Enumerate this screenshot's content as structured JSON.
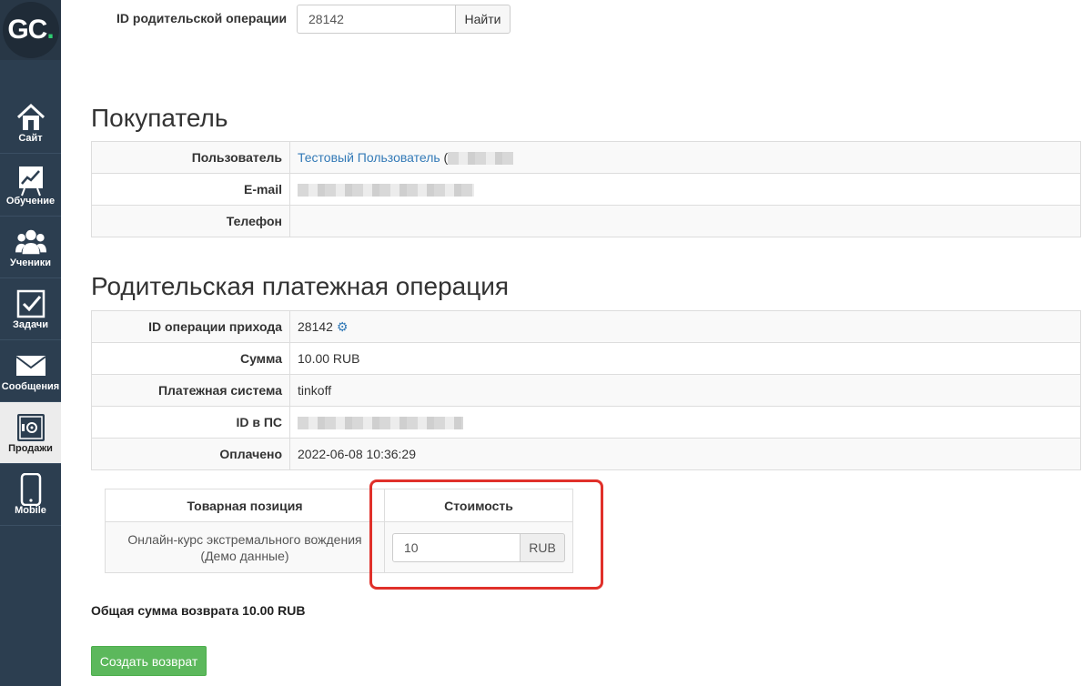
{
  "sidebar": {
    "logo_text": "GC",
    "logo_dot": ".",
    "items": [
      {
        "label": "Сайт",
        "icon": "home-icon"
      },
      {
        "label": "Обучение",
        "icon": "chart-board-icon"
      },
      {
        "label": "Ученики",
        "icon": "users-icon"
      },
      {
        "label": "Задачи",
        "icon": "checkbox-icon"
      },
      {
        "label": "Сообщения",
        "icon": "envelope-icon"
      },
      {
        "label": "Продажи",
        "icon": "safe-icon"
      },
      {
        "label": "Mobile",
        "icon": "phone-icon"
      }
    ],
    "active_index": 5
  },
  "search": {
    "label": "ID родительской операции",
    "value": "28142",
    "button_label": "Найти"
  },
  "buyer": {
    "title": "Покупатель",
    "rows": [
      {
        "key": "Пользователь",
        "value": "Тестовый Пользователь",
        "suffix": "("
      },
      {
        "key": "E-mail",
        "value": ""
      },
      {
        "key": "Телефон",
        "value": ""
      }
    ]
  },
  "parent_operation": {
    "title": "Родительская платежная операция",
    "rows": [
      {
        "key": "ID операции прихода",
        "value": "28142"
      },
      {
        "key": "Сумма",
        "value": "10.00 RUB"
      },
      {
        "key": "Платежная система",
        "value": "tinkoff"
      },
      {
        "key": "ID в ПС",
        "value": ""
      },
      {
        "key": "Оплачено",
        "value": "2022-06-08 10:36:29"
      }
    ]
  },
  "items_table": {
    "headers": {
      "item": "Товарная позиция",
      "cost": "Стоимость"
    },
    "rows": [
      {
        "name": "Онлайн-курс экстремального вождения (Демо данные)",
        "price": "10",
        "currency": "RUB"
      }
    ]
  },
  "summary": {
    "total_text": "Общая сумма возврата 10.00 RUB"
  },
  "actions": {
    "create_label": "Создать возврат"
  },
  "colors": {
    "sidebar_bg": "#2c3e50",
    "logo_dot": "#2ecc71",
    "link": "#337ab7",
    "highlight": "#e0302a",
    "button_success": "#5cb85c"
  }
}
